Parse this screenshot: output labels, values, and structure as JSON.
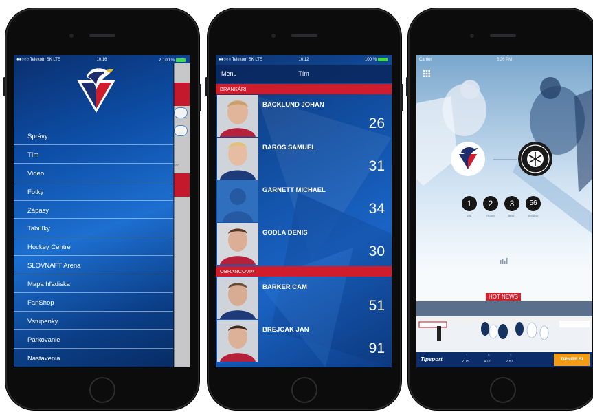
{
  "phone1": {
    "status": {
      "carrier": "●●○○○ Telekom SK  LTE",
      "time": "10:16",
      "battery": "↗ 100 %"
    },
    "menu_items": [
      "Správy",
      "Tím",
      "Video",
      "Fotky",
      "Zápasy",
      "Tabuľky",
      "Hockey Centre",
      "SLOVNAFT Arena",
      "Mapa hľadiska",
      "FanShop",
      "Vstupenky",
      "Parkovanie",
      "Nastavenia"
    ],
    "behind_text": "šno"
  },
  "phone2": {
    "status": {
      "carrier": "●●○○○ Telekom SK  LTE",
      "time": "10:12",
      "battery": "100 %"
    },
    "nav": {
      "menu": "Menu",
      "title": "Tím"
    },
    "sections": [
      {
        "label": "BRANKÁRI"
      },
      {
        "label": "OBRANCOVIA"
      }
    ],
    "players": [
      {
        "name": "BACKLUND JOHAN",
        "number": "26"
      },
      {
        "name": "BAROS SAMUEL",
        "number": "31"
      },
      {
        "name": "GARNETT MICHAEL",
        "number": "34"
      },
      {
        "name": "GODLA DENIS",
        "number": "30"
      },
      {
        "name": "BARKER CAM",
        "number": "51"
      },
      {
        "name": "BREJCAK JAN",
        "number": "91"
      }
    ]
  },
  "phone3": {
    "status": {
      "carrier": "Carrier",
      "time": "5:26 PM"
    },
    "countdown": {
      "values": [
        "1",
        "2",
        "3",
        "56"
      ],
      "labels": [
        "DNÍ",
        "HODIN",
        "MINÚT",
        "SEKÚND"
      ]
    },
    "hot_news": "HOT NEWS",
    "tipsport": {
      "brand": "Tipsport",
      "odds_labels": [
        "1",
        "0",
        "2"
      ],
      "odds_values": [
        "2.15",
        "4.00",
        "2.87"
      ],
      "button": "TIPNITE SI"
    }
  },
  "colors": {
    "brand_red": "#d01d2e",
    "brand_blue": "#0d4fa8",
    "accent_orange": "#f39a16"
  }
}
